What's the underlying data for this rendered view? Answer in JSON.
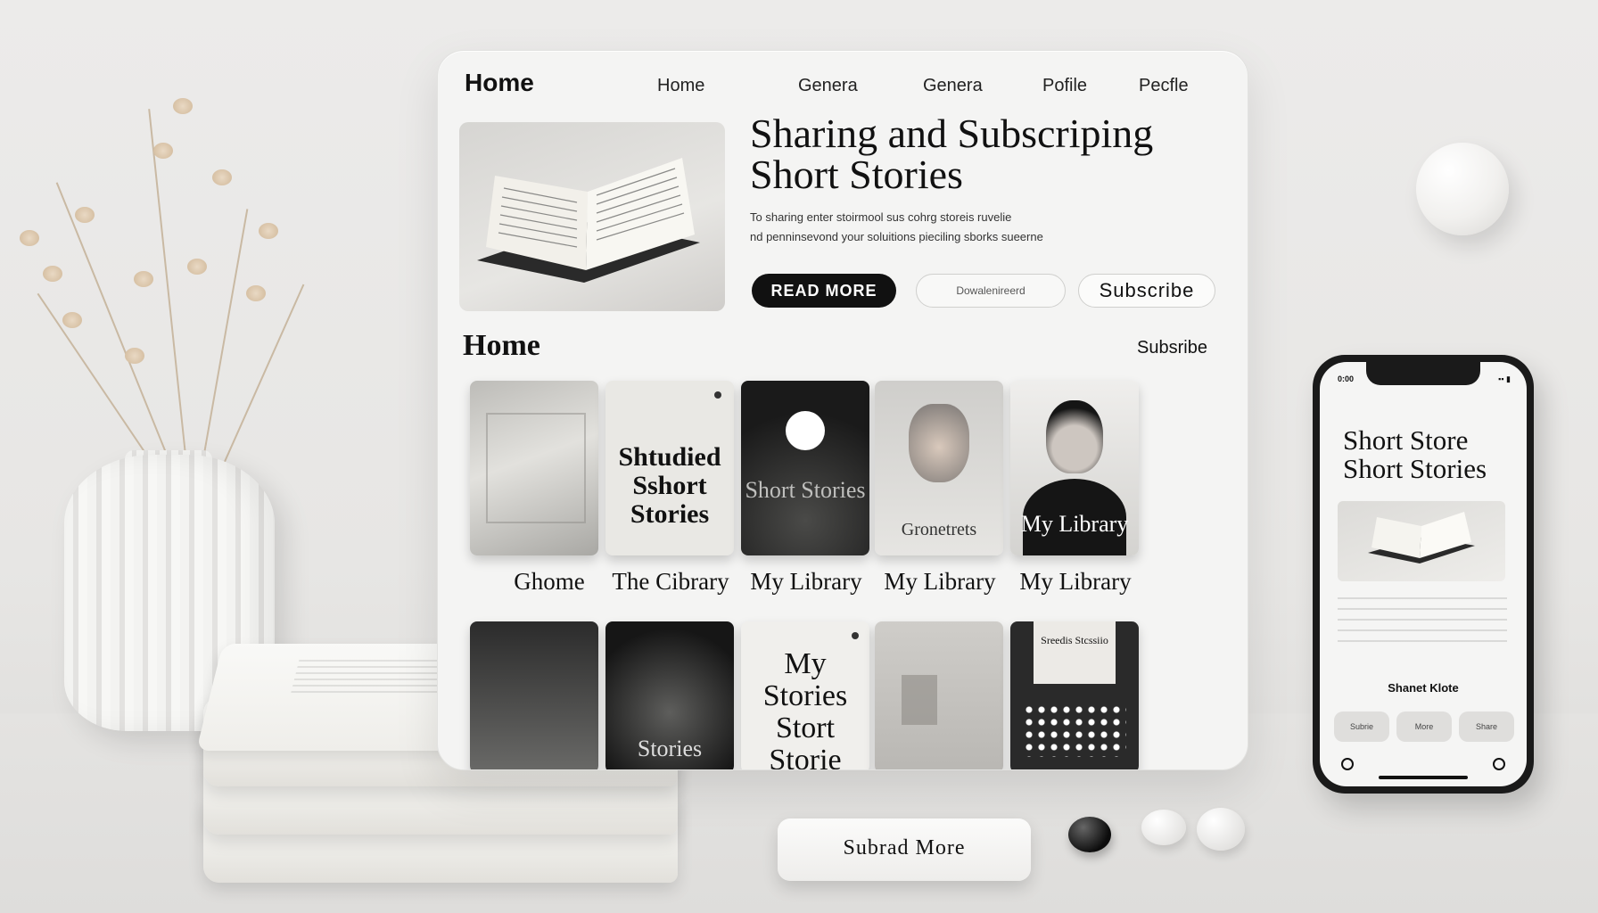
{
  "nav": {
    "logo": "Home",
    "items": [
      "Home",
      "Genera",
      "Genera",
      "Pofile",
      "Pecfle"
    ]
  },
  "hero": {
    "title_line1": "Sharing and Subscriping",
    "title_line2": "Short Stories",
    "subtitle_line1": "To sharing enter stoirmool sus cohrg storeis ruvelie",
    "subtitle_line2": "nd penninsevond your soluitions pieciling sborks sueerne",
    "read_more": "READ MORE",
    "mid_button": "Dowalenireerd",
    "subscribe": "Subscribe"
  },
  "library": {
    "title": "Home",
    "link": "Subsribe",
    "row1": [
      {
        "cover_text": "",
        "caption": "Ghome"
      },
      {
        "cover_text": "Shtudied Sshort Stories",
        "caption": "The Cibrary"
      },
      {
        "cover_text": "Short Stories",
        "caption": "My Library"
      },
      {
        "cover_text": "Gronetrets",
        "caption": "My Library"
      },
      {
        "cover_text": "My Library",
        "caption": "My Library"
      }
    ],
    "row2": [
      {
        "cover_text": ""
      },
      {
        "cover_text": "Stories"
      },
      {
        "cover_text": "My Stories Stort Storie"
      },
      {
        "cover_text": ""
      },
      {
        "cover_text": "Sreedis Stcssiio"
      }
    ]
  },
  "phone": {
    "status_left": "0:00",
    "title_line1": "Short Store",
    "title_line2": "Short Stories",
    "label": "Shanet Klote",
    "buttons": [
      "Subrie",
      "More",
      "Share"
    ]
  },
  "bottom_card": "Subrad More",
  "colors": {
    "accent": "#111111",
    "panel": "#f4f4f3",
    "background": "#e9e8e6"
  }
}
